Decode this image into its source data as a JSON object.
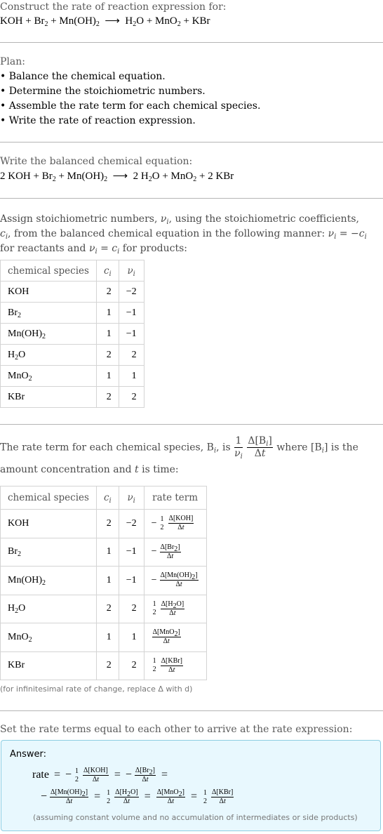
{
  "intro": {
    "header": "Construct the rate of reaction expression for:",
    "reaction": {
      "reactants": [
        "KOH",
        "Br|2",
        "Mn(OH)|2"
      ],
      "products": [
        "H|2|O",
        "MnO|2",
        "KBr"
      ],
      "arrow": "⟶",
      "plus": "+"
    }
  },
  "plan": {
    "header": "Plan:",
    "steps": [
      "• Balance the chemical equation.",
      "• Determine the stoichiometric numbers.",
      "• Assemble the rate term for each chemical species.",
      "• Write the rate of reaction expression."
    ]
  },
  "balanced": {
    "header": "Write the balanced chemical equation:",
    "equation": "2 KOH + Br₂ + Mn(OH)₂ ⟶ 2 H₂O + MnO₂ + 2 KBr"
  },
  "stoich": {
    "text_1": "Assign stoichiometric numbers, ",
    "nu_i": "νi",
    "text_2": ", using the stoichiometric coefficients, ",
    "c_i": "ci",
    "text_3": ", from the balanced chemical equation in the following manner: ",
    "rule_reactants": "νi = −ci",
    "text_4": " for reactants and ",
    "rule_products": "νi = ci",
    "text_5": " for products:",
    "columns": [
      "chemical species",
      "c",
      "ν"
    ],
    "rows": [
      {
        "species": "KOH",
        "c": "2",
        "nu": "−2"
      },
      {
        "species": "Br2",
        "c": "1",
        "nu": "−1"
      },
      {
        "species": "Mn(OH)2",
        "c": "1",
        "nu": "−1"
      },
      {
        "species": "H2O",
        "c": "2",
        "nu": "2"
      },
      {
        "species": "MnO2",
        "c": "1",
        "nu": "1"
      },
      {
        "species": "KBr",
        "c": "2",
        "nu": "2"
      }
    ]
  },
  "rate_terms": {
    "text_1": "The rate term for each chemical species, B",
    "text_2": ", is ",
    "text_3": " where [B",
    "text_4": "] is the amount concentration and ",
    "t": "t",
    "text_5": " is time:",
    "columns": [
      "chemical species",
      "c",
      "ν",
      "rate term"
    ],
    "rows": [
      {
        "species": "KOH",
        "c": "2",
        "nu": "−2",
        "sign": "−",
        "coef": "1/2",
        "conc": "KOH"
      },
      {
        "species": "Br2",
        "c": "1",
        "nu": "−1",
        "sign": "−",
        "coef": "",
        "conc": "Br2"
      },
      {
        "species": "Mn(OH)2",
        "c": "1",
        "nu": "−1",
        "sign": "−",
        "coef": "",
        "conc": "Mn(OH)2"
      },
      {
        "species": "H2O",
        "c": "2",
        "nu": "2",
        "sign": "",
        "coef": "1/2",
        "conc": "H2O"
      },
      {
        "species": "MnO2",
        "c": "1",
        "nu": "1",
        "sign": "",
        "coef": "",
        "conc": "MnO2"
      },
      {
        "species": "KBr",
        "c": "2",
        "nu": "2",
        "sign": "",
        "coef": "1/2",
        "conc": "KBr"
      }
    ],
    "note": "(for infinitesimal rate of change, replace Δ with d)"
  },
  "final": {
    "header": "Set the rate terms equal to each other to arrive at the rate expression:",
    "answer_label": "Answer:",
    "rate_word": "rate",
    "note": "(assuming constant volume and no accumulation of intermediates or side products)"
  }
}
